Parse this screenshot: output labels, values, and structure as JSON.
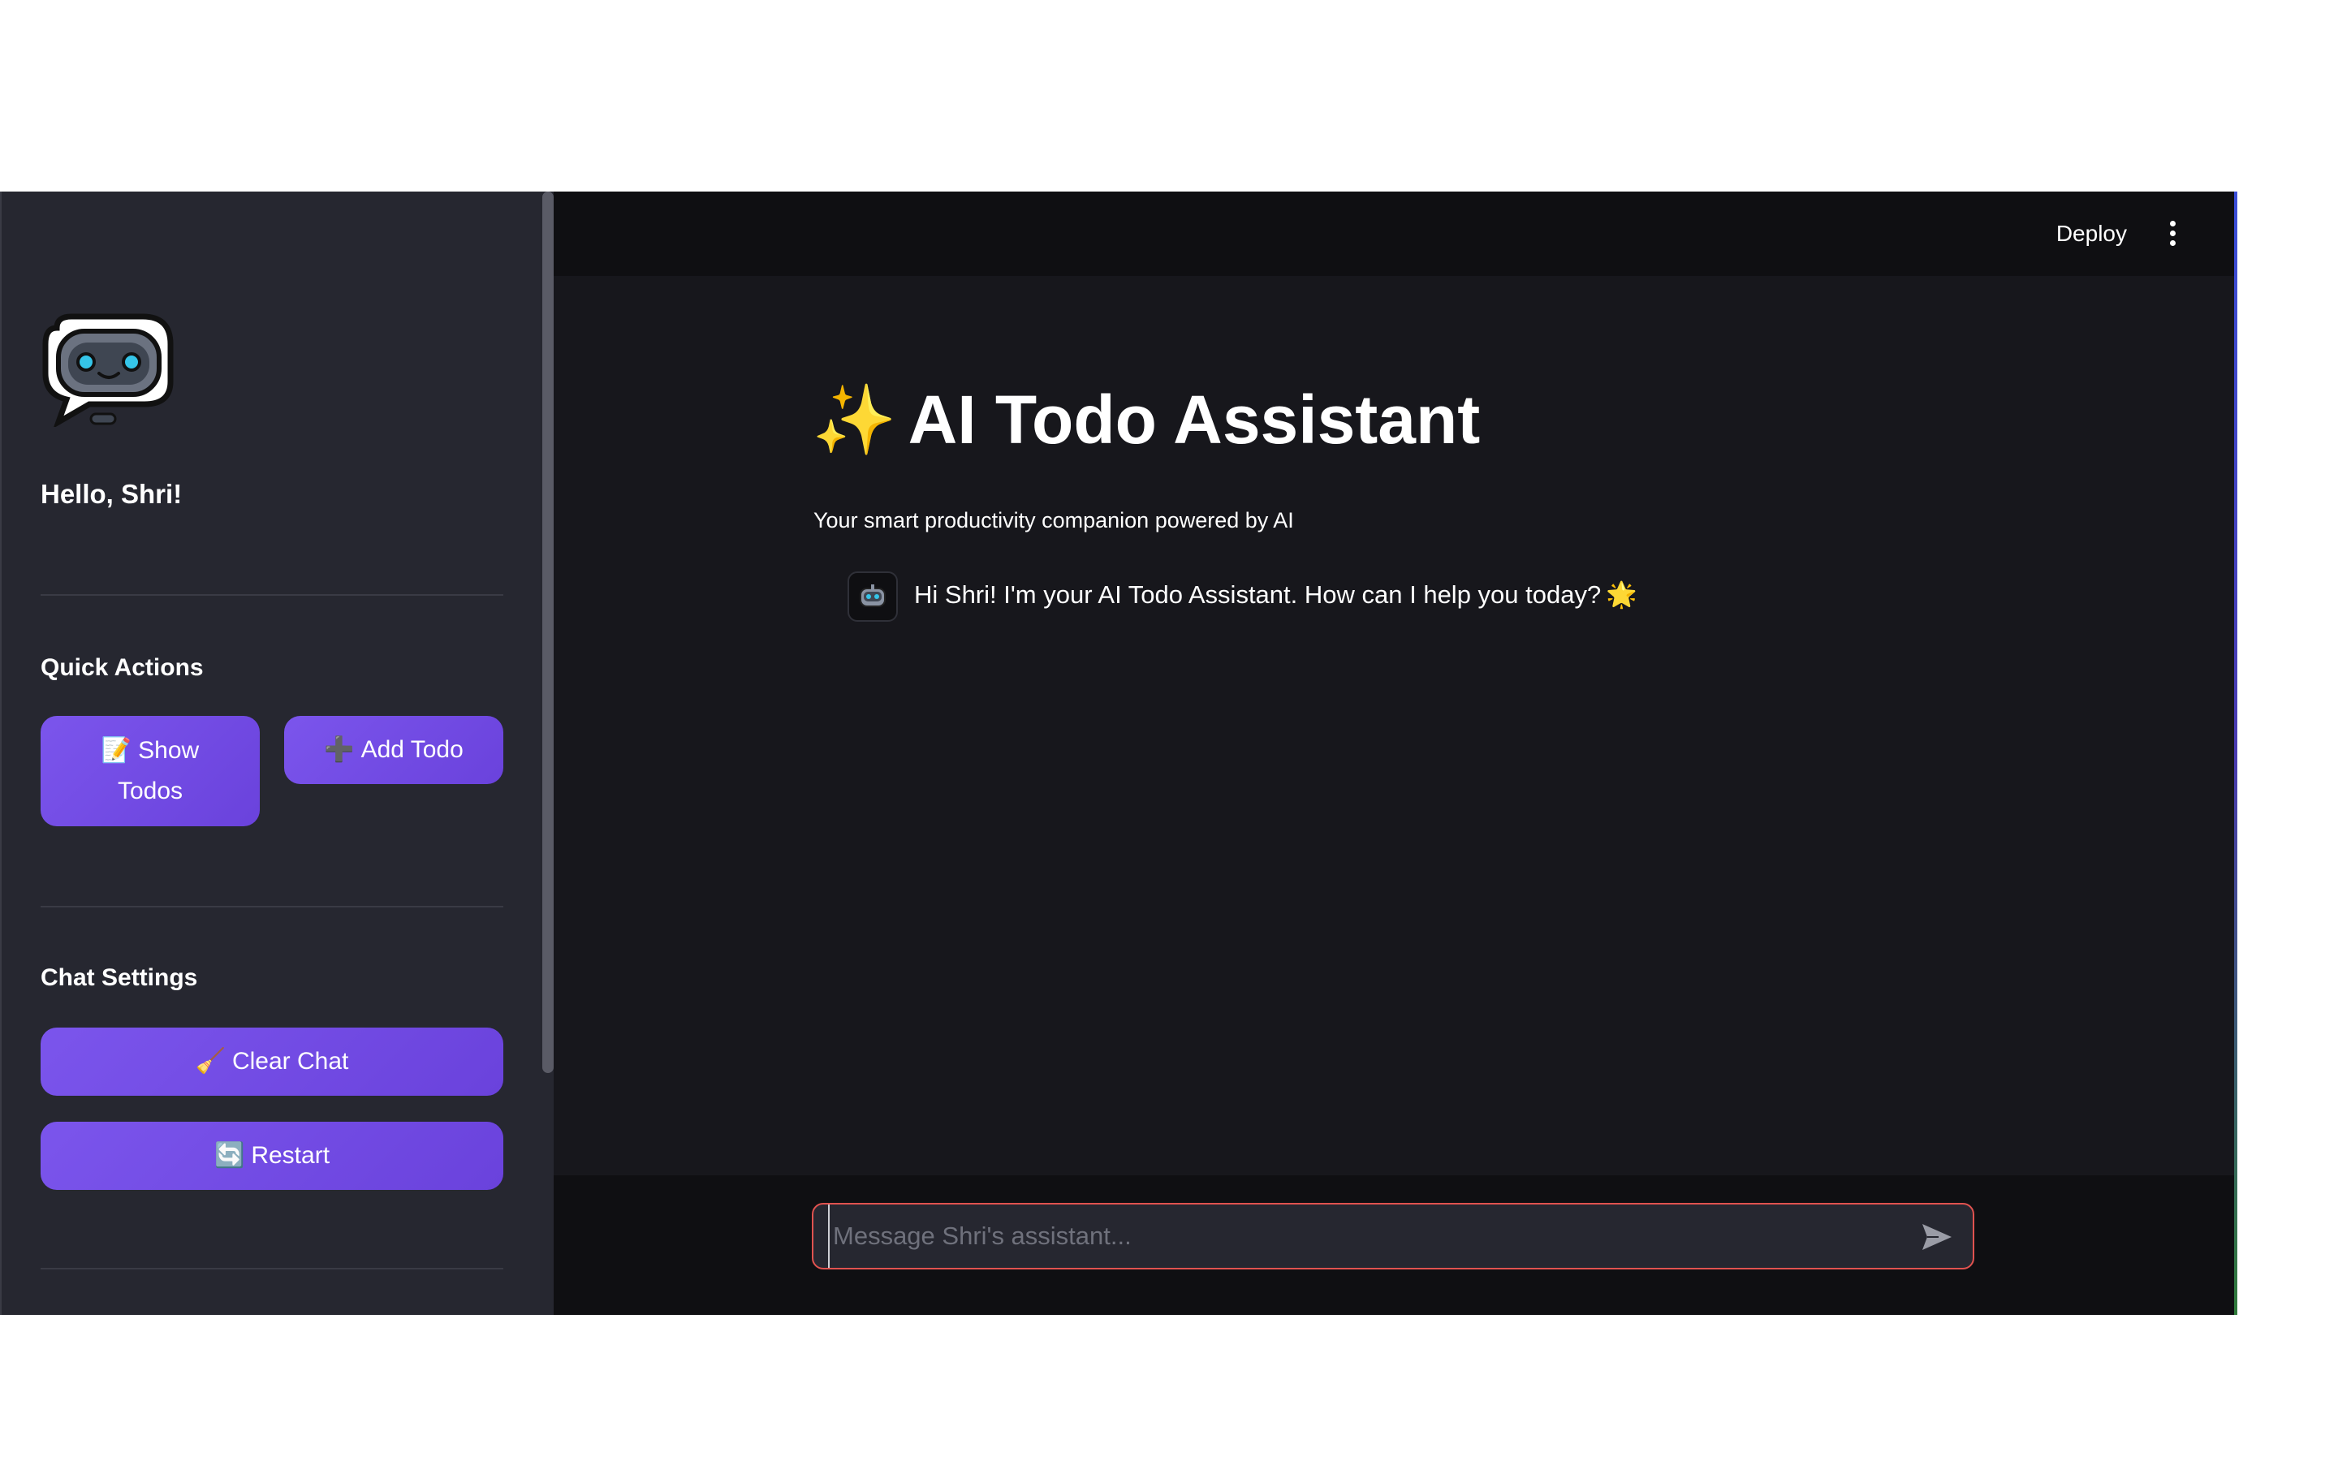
{
  "sidebar": {
    "logo_icon": "robot-chat-bubble-icon",
    "greeting": "Hello, Shri!",
    "quick_actions": {
      "title": "Quick Actions",
      "show_todos": {
        "emoji": "📝",
        "label_line1": "Show",
        "label_line2": "Todos"
      },
      "add_todo": {
        "emoji": "➕",
        "label": "Add Todo"
      }
    },
    "chat_settings": {
      "title": "Chat Settings",
      "clear_chat": {
        "emoji": "🧹",
        "label": "Clear Chat"
      },
      "restart": {
        "emoji": "🔄",
        "label": "Restart"
      }
    }
  },
  "header": {
    "deploy_label": "Deploy",
    "menu_icon": "kebab-menu-icon"
  },
  "main": {
    "title_emoji": "✨",
    "title": "AI Todo Assistant",
    "subtitle": "Your smart productivity companion powered by AI",
    "messages": [
      {
        "role": "assistant",
        "avatar_icon": "robot-icon",
        "text": "Hi Shri! I'm your AI Todo Assistant. How can I help you today?",
        "trailing_emoji": "🌟"
      }
    ]
  },
  "chat_input": {
    "placeholder": "Message Shri's assistant...",
    "value": "",
    "send_icon": "send-icon"
  },
  "colors": {
    "accent": "#7b55ec",
    "sidebar_bg": "#262730",
    "main_bg": "#17171c",
    "input_border": "#e0524f"
  }
}
